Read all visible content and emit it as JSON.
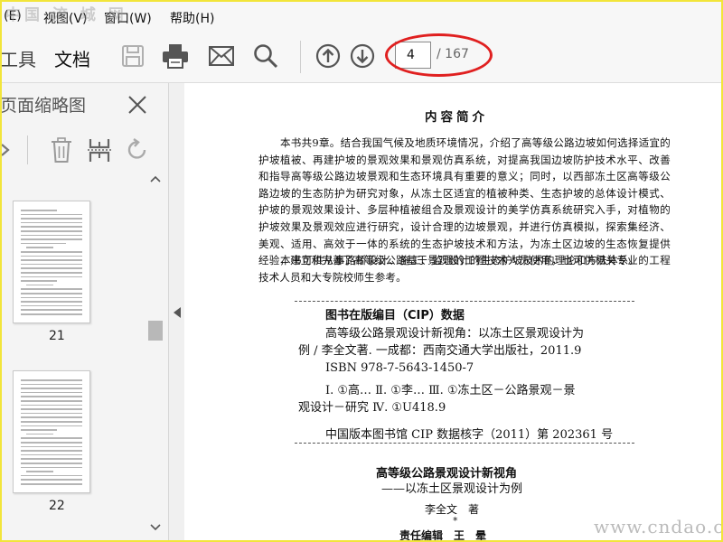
{
  "watermark_top": "中国 流 城 网",
  "watermark_bottom": "www.cndao.com",
  "menu": {
    "edit": "(E)",
    "view": "视图(V)",
    "window": "窗口(W)",
    "help": "帮助(H)"
  },
  "toolbar": {
    "tab_tools": "工具",
    "tab_document": "文档",
    "page_current": "4",
    "page_total": "/ 167",
    "icons": [
      "save-icon",
      "print-icon",
      "mail-icon",
      "search-icon",
      "prev-page-icon",
      "next-page-icon"
    ]
  },
  "sidebar": {
    "title": "页面缩略图",
    "thumbnails": [
      {
        "page_label": "21"
      },
      {
        "page_label": "22"
      }
    ]
  },
  "document": {
    "title": "内容简介",
    "para1": "本书共9章。结合我国气候及地质环境情况，介绍了高等级公路边坡如何选择适宜的护坡植被、再建护坡的景观效果和景观仿真系统，对提高我国边坡防护技术水平、改善和指导高等级公路边坡景观和生态环境具有重要的意义；同时，以西部冻土区高等级公路边坡的生态防护为研究对象，从冻土区适宜的植被种类、生态护坡的总体设计模式、护坡的景观效果设计、多层种植被组合及景观设计的美学仿真系统研究入手，对植物的护坡效果及景观效应进行研究，设计合理的边坡景观，并进行仿真模拟，探索集经济、美观、适用、高效于一体的系统的生态护坡技术和方法，为冻土区边坡的生态恢复提供经验，建立和完善了高等级公路基于景观设计的生态护坡技术的理论和方法体系。",
    "para2": "本书可供从事路桥设计、施工、监理的工程技术人员使用，也可供相关专业的工程技术人员和大专院校师生参考。",
    "cip_heading": "图书在版编目（CIP）数据",
    "cip_line1": "高等级公路景观设计新视角：以冻土区景观设计为",
    "cip_line2": "例 / 李全文著. 一成都：西南交通大学出版社，2011.9",
    "cip_line3": "ISBN 978-7-5643-1450-7",
    "cip_line4": "Ⅰ. ①高… Ⅱ. ①李… Ⅲ. ①冻土区－公路景观－景",
    "cip_line5": "观设计－研究 Ⅳ. ①U418.9",
    "cip_number": "中国版本图书馆 CIP 数据核字（2011）第 202361 号",
    "book_title": "高等级公路景观设计新视角",
    "book_subtitle": "——以冻土区景观设计为例",
    "author": "李全文　著",
    "star": "*",
    "editor": "责任编辑　王　晕"
  },
  "colors": {
    "highlight_frame": "#f2e53a",
    "annotation_red": "#e02020",
    "toolbar_bg": "#f7f7f7",
    "sidebar_bg": "#f4f4f4"
  }
}
